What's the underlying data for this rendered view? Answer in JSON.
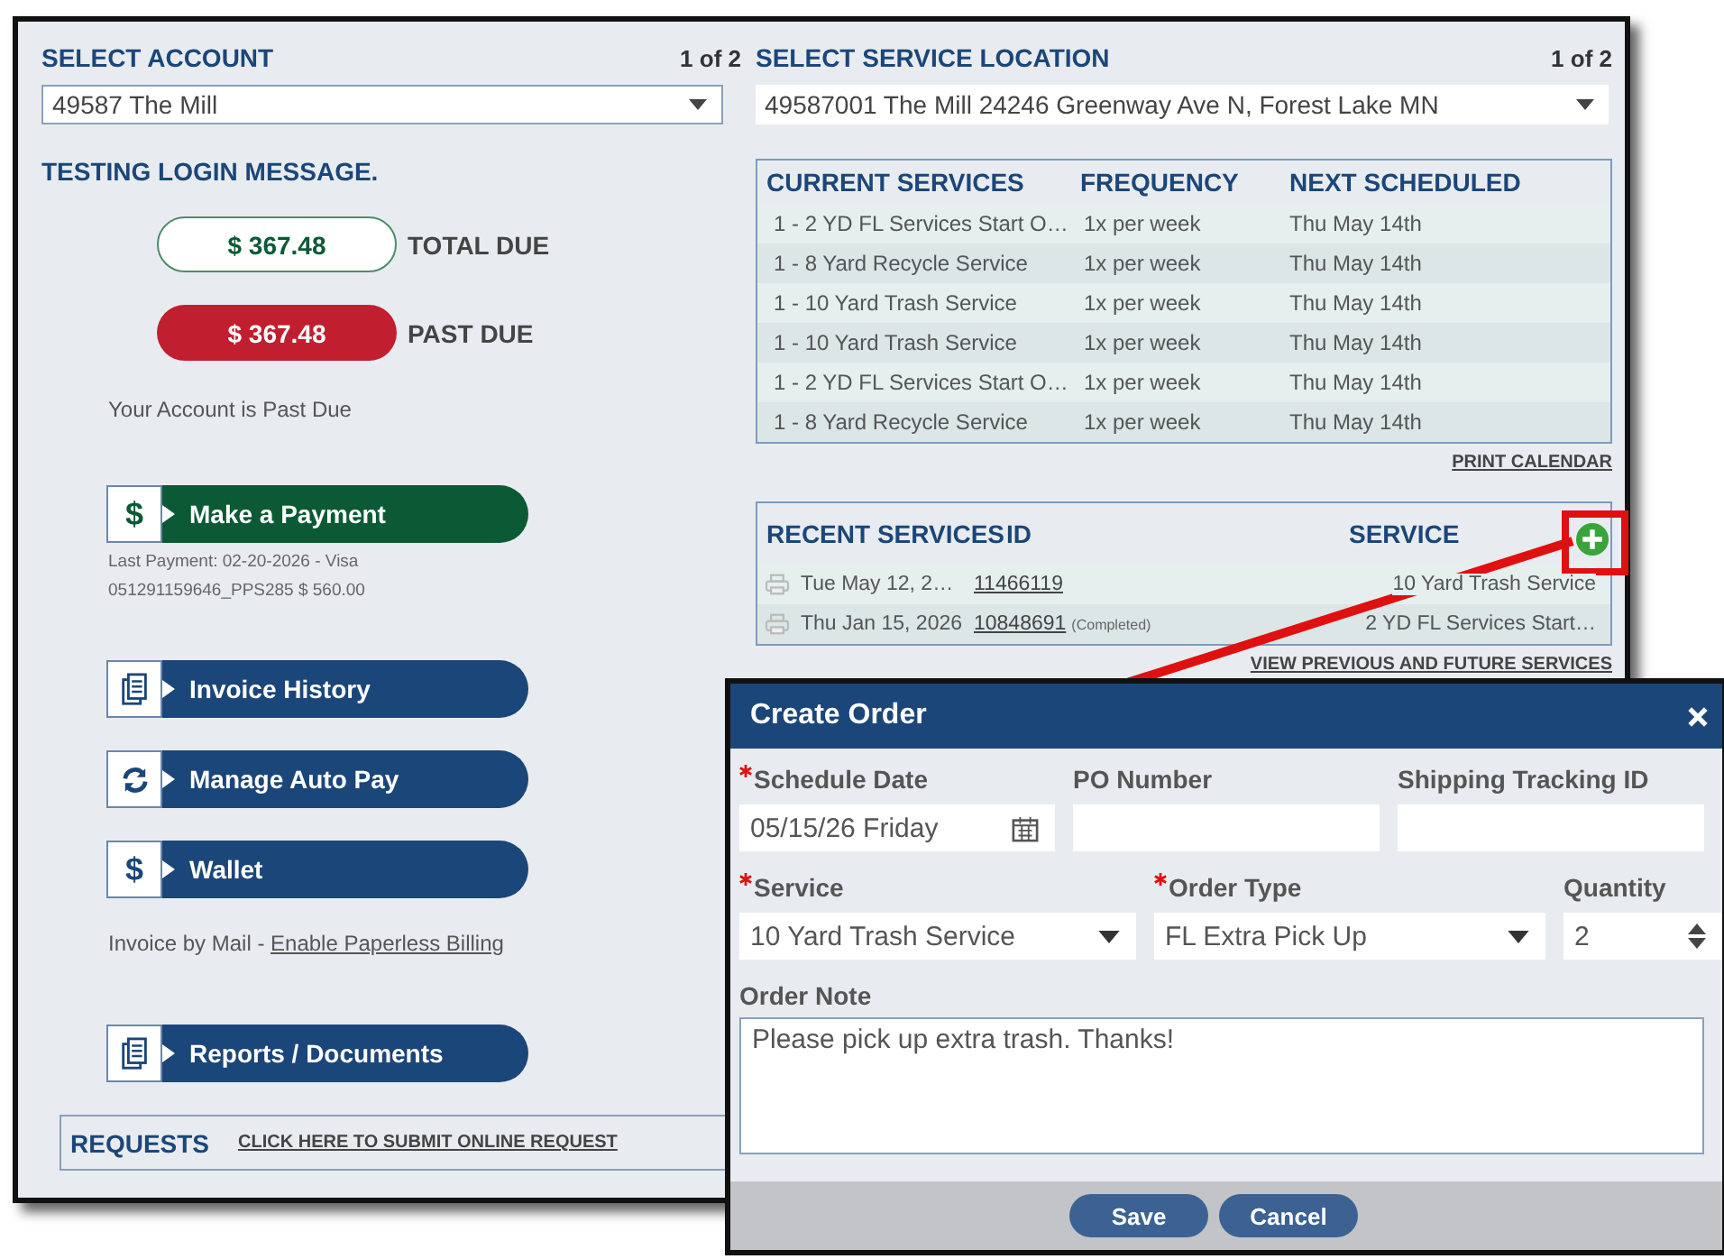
{
  "account": {
    "heading": "SELECT ACCOUNT",
    "pager": "1 of 2",
    "value": "49587 The Mill"
  },
  "message": "TESTING LOGIN MESSAGE.",
  "balances": [
    {
      "kind": "total",
      "amount": "$ 367.48",
      "label": "TOTAL DUE"
    },
    {
      "kind": "past",
      "amount": "$ 367.48",
      "label": "PAST DUE"
    }
  ],
  "status_note": "Your Account is Past Due",
  "actions": [
    {
      "kind": "payment",
      "symbol": "$",
      "label": "Make a Payment",
      "details": [
        "Last Payment: 02-20-2026 - Visa",
        "051291159646_PPS285  $ 560.00"
      ]
    },
    {
      "kind": "invoices",
      "label": "Invoice History"
    },
    {
      "kind": "autopay",
      "label": "Manage Auto Pay"
    },
    {
      "kind": "wallet",
      "symbol": "$",
      "label": "Wallet",
      "note": {
        "text": "Invoice by Mail - ",
        "link": "Enable Paperless Billing"
      }
    },
    {
      "kind": "reports",
      "label": "Reports / Documents"
    }
  ],
  "requests": {
    "heading": "REQUESTS",
    "link": "CLICK HERE TO SUBMIT ONLINE REQUEST"
  },
  "location": {
    "heading": "SELECT SERVICE LOCATION",
    "pager": "1 of 2",
    "value": "49587001 The Mill 24246 Greenway Ave N, Forest Lake MN"
  },
  "current_services": {
    "columns": [
      "CURRENT SERVICES",
      "FREQUENCY",
      "NEXT SCHEDULED"
    ],
    "rows": [
      [
        "1 - 2 YD FL Services Start O…",
        "1x per week",
        "Thu May 14th"
      ],
      [
        "1 - 8 Yard Recycle Service",
        "1x per week",
        "Thu May 14th"
      ],
      [
        "1 - 10 Yard Trash Service",
        "1x per week",
        "Thu May 14th"
      ],
      [
        "1 - 10 Yard Trash Service",
        "1x per week",
        "Thu May 14th"
      ],
      [
        "1 - 2 YD FL Services Start O…",
        "1x per week",
        "Thu May 14th"
      ],
      [
        "1 - 8 Yard Recycle Service",
        "1x per week",
        "Thu May 14th"
      ]
    ]
  },
  "print_link": "PRINT CALENDAR",
  "recent_services": {
    "columns": [
      "RECENT SERVICES",
      "ID",
      "SERVICE"
    ],
    "rows": [
      {
        "date": "Tue May 12, 2…",
        "id": "11466119",
        "service": "10 Yard Trash Service"
      },
      {
        "date": "Thu Jan 15, 2026",
        "id": "10848691",
        "status": "(Completed)",
        "service": "2 YD FL Services Start…"
      }
    ]
  },
  "view_link": "VIEW PREVIOUS AND FUTURE SERVICES",
  "dialog": {
    "title": "Create Order",
    "fields": [
      {
        "kind": "date",
        "label": "Schedule Date",
        "required": true,
        "value": "05/15/26 Friday"
      },
      {
        "kind": "text",
        "label": "PO Number",
        "required": false
      },
      {
        "kind": "text",
        "label": "Shipping Tracking ID",
        "required": false
      },
      {
        "kind": "select",
        "label": "Service",
        "required": true,
        "value": "10 Yard Trash Service"
      },
      {
        "kind": "select",
        "label": "Order Type",
        "required": true,
        "value": "FL Extra Pick Up"
      },
      {
        "kind": "number",
        "label": "Quantity",
        "required": false,
        "value": "2"
      },
      {
        "kind": "textarea",
        "label": "Order Note",
        "required": false,
        "value": "Please pick up extra trash. Thanks!"
      }
    ],
    "buttons": [
      "Save",
      "Cancel"
    ]
  }
}
